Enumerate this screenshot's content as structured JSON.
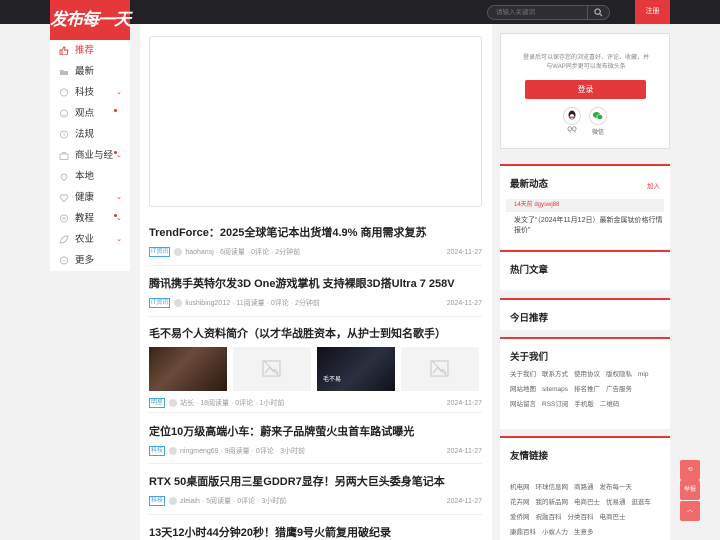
{
  "header": {
    "logo_text": "发布每一天",
    "search_placeholder": "请输入关键词",
    "register_label": "注册"
  },
  "nav": {
    "items": [
      {
        "label": "推荐",
        "icon": "thumb-up-icon",
        "active": true
      },
      {
        "label": "最新",
        "icon": "clock-icon"
      },
      {
        "label": "科技",
        "icon": "chip-icon",
        "arrow": true
      },
      {
        "label": "观点",
        "icon": "bulb-icon",
        "dot": true
      },
      {
        "label": "法规",
        "icon": "scale-icon"
      },
      {
        "label": "商业与经",
        "icon": "briefcase-icon",
        "dot": true,
        "arrow": true
      },
      {
        "label": "本地",
        "icon": "location-icon"
      },
      {
        "label": "健康",
        "icon": "heart-icon",
        "arrow": true
      },
      {
        "label": "教程",
        "icon": "book-icon",
        "dot": true,
        "arrow": true
      },
      {
        "label": "农业",
        "icon": "leaf-icon",
        "arrow": true
      },
      {
        "label": "更多",
        "icon": "more-icon"
      }
    ]
  },
  "articles": [
    {
      "title": "TrendForce：2025全球笔记本出货增4.9% 商用需求复苏",
      "tag": "IT资讯",
      "author": "haohansj",
      "reads": "6阅读量",
      "comments": "0评论",
      "ago": "2分钟前",
      "date": "2024-11-27"
    },
    {
      "title": "腾讯携手英特尔发3D One游戏掌机 支持裸眼3D搭Ultra 7 258V",
      "tag": "IT资讯",
      "author": "liushibing2012",
      "reads": "11阅读量",
      "comments": "0评论",
      "ago": "2分钟前",
      "date": "2024-11-27"
    },
    {
      "title": "毛不易个人资料简介（以才华战胜资本，从护士到知名歌手）",
      "tag": "明星",
      "author": "站长",
      "reads": "18阅读量",
      "comments": "0评论",
      "ago": "1小时前",
      "date": "2024-11-27",
      "thumb_caption": "毛不易"
    },
    {
      "title": "定位10万级高端小车：蔚来子品牌萤火虫首车路试曝光",
      "tag": "科技",
      "author": "ningmeng69",
      "reads": "9阅读量",
      "comments": "0评论",
      "ago": "3小时前",
      "date": "2024-11-27"
    },
    {
      "title": "RTX 50桌面版只用三星GDDR7显存！另两大巨头委身笔记本",
      "tag": "科技",
      "author": "zleiaih",
      "reads": "5阅读量",
      "comments": "0评论",
      "ago": "3小时前",
      "date": "2024-11-27"
    },
    {
      "title": "13天12小时44分钟20秒！猎鹰9号火箭复用破纪录"
    }
  ],
  "sidebar": {
    "login_desc": "登录后可以保存您的浏览喜好、评论、收藏，并与WAP同步更可以发布微头条",
    "login_button": "登录",
    "qq_label": "QQ",
    "wechat_label": "微信",
    "news_title": "最新动态",
    "news_add": "加入",
    "news_time": "14天前 dgyswj88",
    "news_text": "发文了“（2024年11月12日）最新金属钛价格行情报价”",
    "hot_title": "热门文章",
    "today_title": "今日推荐",
    "about_title": "关于我们",
    "about_links": [
      "关于我们",
      "联系方式",
      "使用协议",
      "版权隐私",
      "mip",
      "网站地图",
      "sitemaps",
      "排名推广",
      "广告服务",
      "网站留言",
      "RSS订阅",
      "手机版",
      "二维码"
    ],
    "friends_title": "友情链接",
    "friend_links": [
      "机电网",
      "环球信息网",
      "商路通",
      "发布每一天",
      "花卉网",
      "我的新品网",
      "电商巴士",
      "优易通",
      "逛逛车",
      "爱侨网",
      "祝融百科",
      "分类百科",
      "电商巴士",
      "康鼎百科",
      "小蚁人力",
      "生意多"
    ]
  },
  "float_buttons": {
    "share": "⟲",
    "report": "举报",
    "top": "︿"
  },
  "colors": {
    "accent": "#e5383b",
    "topbar": "#222226",
    "tag": "#4aa3df"
  }
}
